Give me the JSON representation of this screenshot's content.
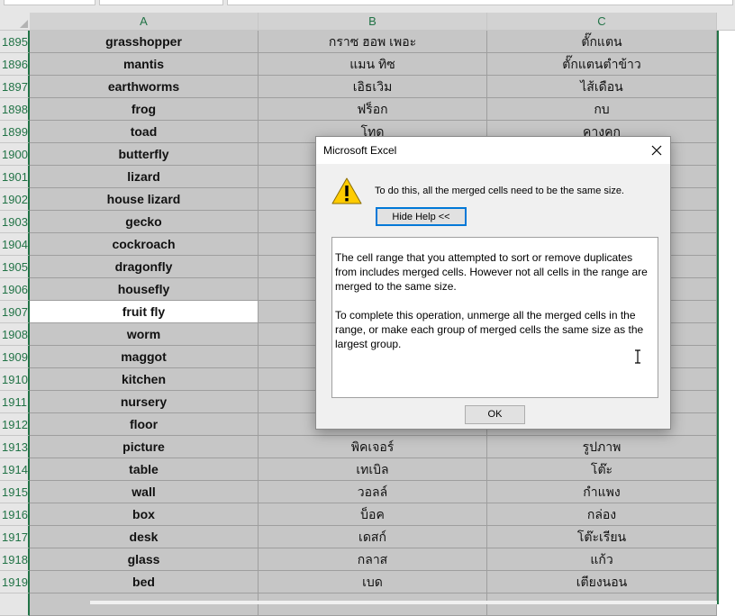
{
  "columns": [
    "A",
    "B",
    "C"
  ],
  "rows": [
    {
      "num": "1895",
      "a": "grasshopper",
      "b": "กราซ ฮอพ เพอะ",
      "c": "ตั๊กแตน"
    },
    {
      "num": "1896",
      "a": "mantis",
      "b": "แมน ทิซ",
      "c": "ตั๊กแตนตำข้าว"
    },
    {
      "num": "1897",
      "a": "earthworms",
      "b": "เอิธเวิม",
      "c": "ไส้เดือน"
    },
    {
      "num": "1898",
      "a": "frog",
      "b": "ฟร็อก",
      "c": "กบ"
    },
    {
      "num": "1899",
      "a": "toad",
      "b": "โทด",
      "c": "คางคก"
    },
    {
      "num": "1900",
      "a": "butterfly",
      "b": "",
      "c": ""
    },
    {
      "num": "1901",
      "a": "lizard",
      "b": "",
      "c": ""
    },
    {
      "num": "1902",
      "a": "house lizard",
      "b": "",
      "c": ""
    },
    {
      "num": "1903",
      "a": "gecko",
      "b": "",
      "c": ""
    },
    {
      "num": "1904",
      "a": "cockroach",
      "b": "",
      "c": ""
    },
    {
      "num": "1905",
      "a": "dragonfly",
      "b": "",
      "c": ""
    },
    {
      "num": "1906",
      "a": "housefly",
      "b": "",
      "c": ""
    },
    {
      "num": "1907",
      "a": "fruit fly",
      "b": "",
      "c": ""
    },
    {
      "num": "1908",
      "a": "worm",
      "b": "",
      "c": ""
    },
    {
      "num": "1909",
      "a": "maggot",
      "b": "",
      "c": ""
    },
    {
      "num": "1910",
      "a": "kitchen",
      "b": "",
      "c": ""
    },
    {
      "num": "1911",
      "a": "nursery",
      "b": "",
      "c": ""
    },
    {
      "num": "1912",
      "a": "floor",
      "b": "",
      "c": ""
    },
    {
      "num": "1913",
      "a": "picture",
      "b": "พิคเจอร์",
      "c": "รูปภาพ"
    },
    {
      "num": "1914",
      "a": "table",
      "b": "เทเบิล",
      "c": "โต๊ะ"
    },
    {
      "num": "1915",
      "a": "wall",
      "b": "วอลล์",
      "c": "กำแพง"
    },
    {
      "num": "1916",
      "a": "box",
      "b": "บ็อค",
      "c": "กล่อง"
    },
    {
      "num": "1917",
      "a": "desk",
      "b": "เดสก์",
      "c": "โต๊ะเรียน"
    },
    {
      "num": "1918",
      "a": "glass",
      "b": "กลาส",
      "c": "แก้ว"
    },
    {
      "num": "1919",
      "a": "bed",
      "b": "เบด",
      "c": "เตียงนอน"
    }
  ],
  "active_row": "1907",
  "dialog": {
    "title": "Microsoft Excel",
    "message": "To do this, all the merged cells need to be the same size.",
    "help_button": "Hide Help <<",
    "details_p1": "The cell range that you attempted to sort or remove duplicates from includes merged cells. However not all cells in the range are merged to the same size.",
    "details_p2": "To complete this operation, unmerge all the merged cells in the range, or make each group of merged cells the same size as the largest group.",
    "ok_button": "OK",
    "icon": "warning-icon",
    "close_icon": "close-icon"
  },
  "colors": {
    "accent": "#217346",
    "selection": "#c6c6c6",
    "focus": "#0078d7",
    "warning": "#ffcc00"
  }
}
